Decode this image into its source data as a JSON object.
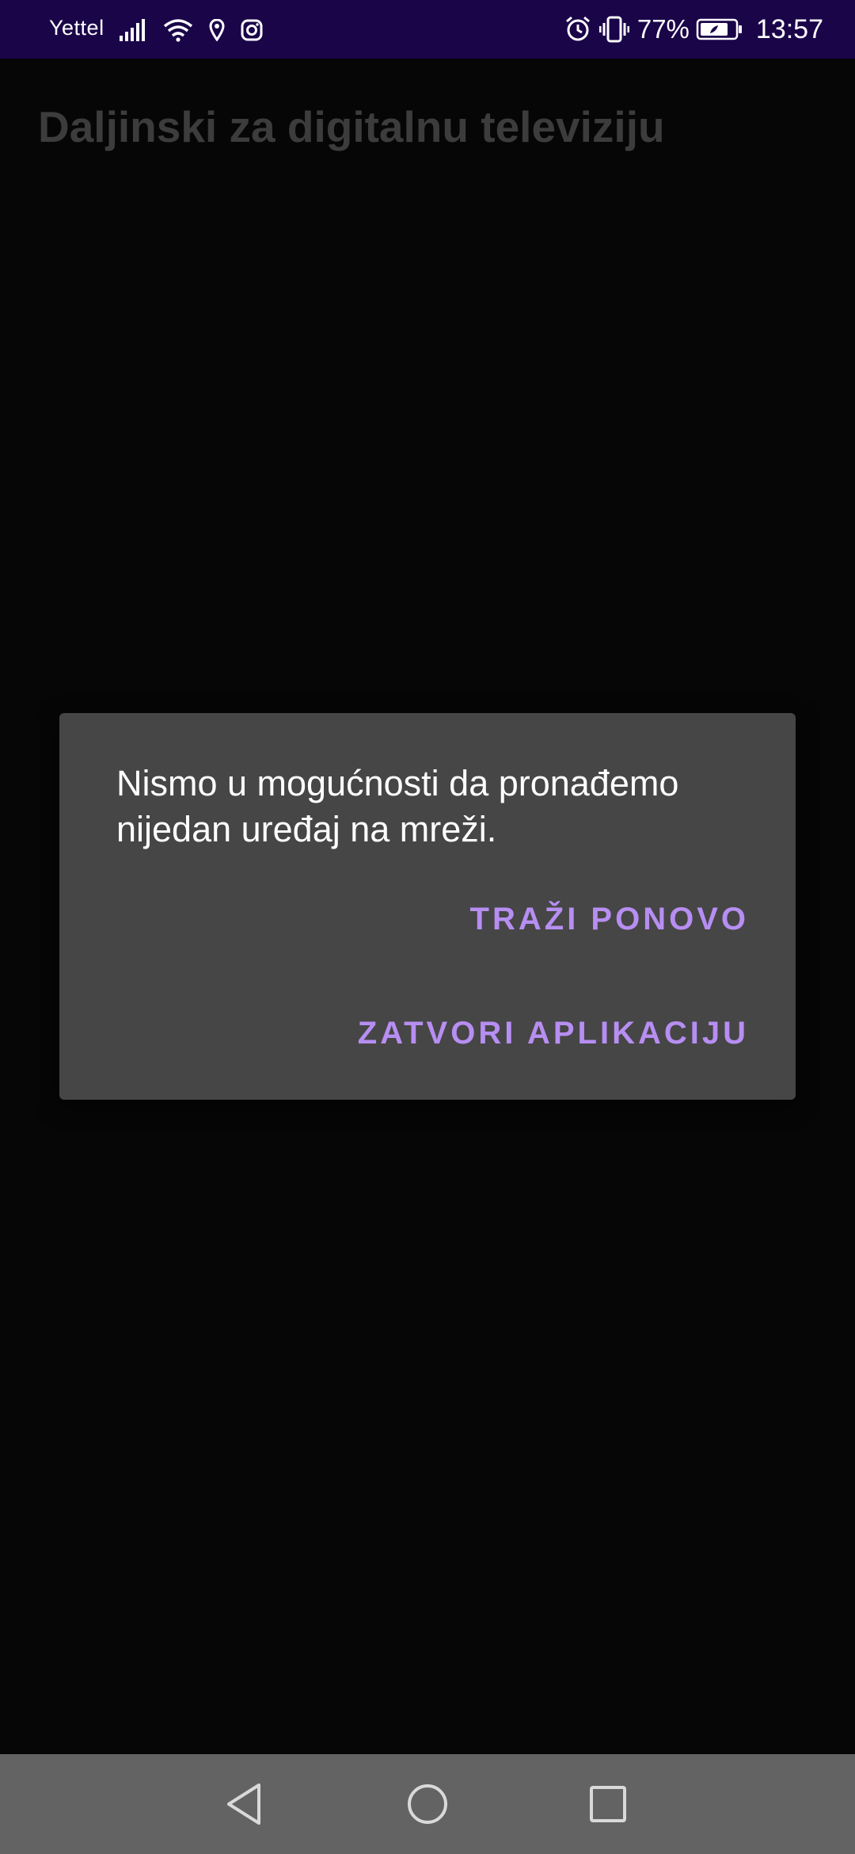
{
  "status_bar": {
    "carrier": "Yettel",
    "battery_percent": "77%",
    "time": "13:57",
    "icons_left": [
      "signal-icon",
      "wifi-icon",
      "location-icon",
      "instagram-icon"
    ],
    "icons_right": [
      "alarm-icon",
      "vibrate-icon",
      "battery-icon"
    ],
    "background": "#1a0549"
  },
  "app": {
    "title": "Daljinski za digitalnu televiziju"
  },
  "dialog": {
    "message": "Nismo u mogućnosti da pronađemo nijedan uređaj na mreži.",
    "retry_label": "TRAŽI PONOVO",
    "close_label": "ZATVORI APLIKACIJU",
    "accent_color": "#b78ef2"
  },
  "nav_bar": {
    "buttons": [
      "back-icon",
      "home-icon",
      "recents-icon"
    ]
  }
}
